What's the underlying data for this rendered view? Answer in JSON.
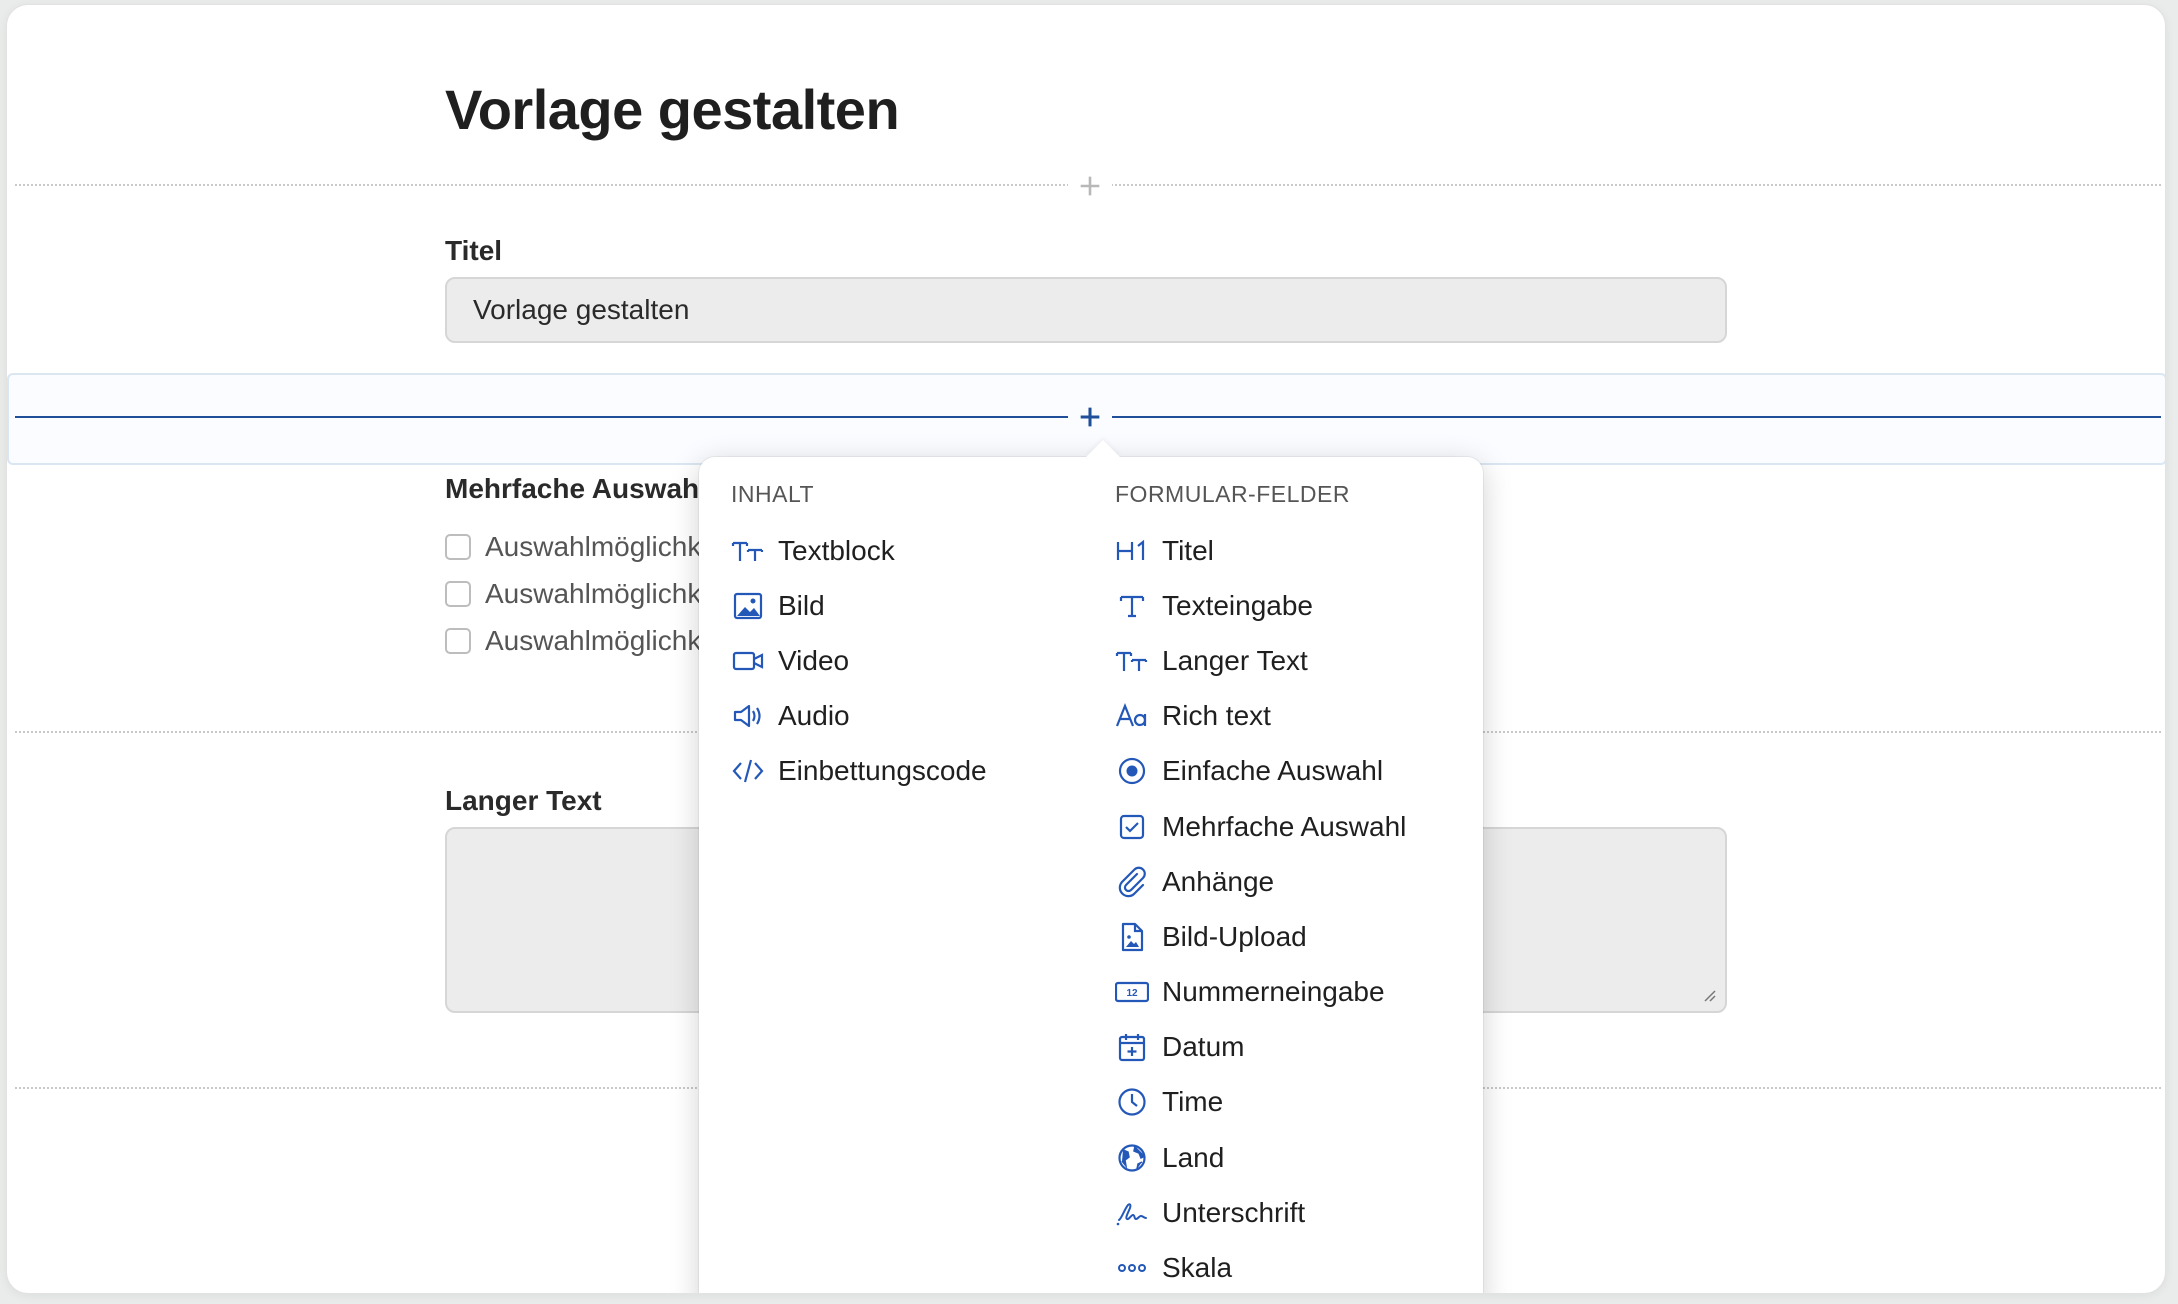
{
  "page": {
    "title": "Vorlage gestalten"
  },
  "fields": {
    "title_field": {
      "label": "Titel",
      "value": "Vorlage gestalten"
    },
    "multi_choice": {
      "label": "Mehrfache Auswahl",
      "options": [
        "Auswahlmöglichkeit 1",
        "Auswahlmöglichkeit 2",
        "Auswahlmöglichkeit 3"
      ]
    },
    "long_text": {
      "label": "Langer Text"
    }
  },
  "insert_menu": {
    "content_heading": "INHALT",
    "content_items": [
      {
        "label": "Textblock",
        "icon": "text-size-icon"
      },
      {
        "label": "Bild",
        "icon": "image-icon"
      },
      {
        "label": "Video",
        "icon": "video-icon"
      },
      {
        "label": "Audio",
        "icon": "speaker-icon"
      },
      {
        "label": "Einbettungscode",
        "icon": "code-icon"
      }
    ],
    "form_heading": "FORMULAR-FELDER",
    "form_items": [
      {
        "label": "Titel",
        "icon": "heading-icon"
      },
      {
        "label": "Texteingabe",
        "icon": "text-icon"
      },
      {
        "label": "Langer Text",
        "icon": "text-size-icon"
      },
      {
        "label": "Rich text",
        "icon": "font-icon"
      },
      {
        "label": "Einfache Auswahl",
        "icon": "radio-icon"
      },
      {
        "label": "Mehrfache Auswahl",
        "icon": "checkbox-icon"
      },
      {
        "label": "Anhänge",
        "icon": "paperclip-icon"
      },
      {
        "label": "Bild-Upload",
        "icon": "image-file-icon"
      },
      {
        "label": "Nummerneingabe",
        "icon": "number-icon"
      },
      {
        "label": "Datum",
        "icon": "calendar-icon"
      },
      {
        "label": "Time",
        "icon": "clock-icon"
      },
      {
        "label": "Land",
        "icon": "globe-icon"
      },
      {
        "label": "Unterschrift",
        "icon": "signature-icon"
      },
      {
        "label": "Skala",
        "icon": "scale-icon"
      }
    ]
  },
  "colors": {
    "accent": "#2458b8",
    "active_line": "#1f4f99"
  }
}
